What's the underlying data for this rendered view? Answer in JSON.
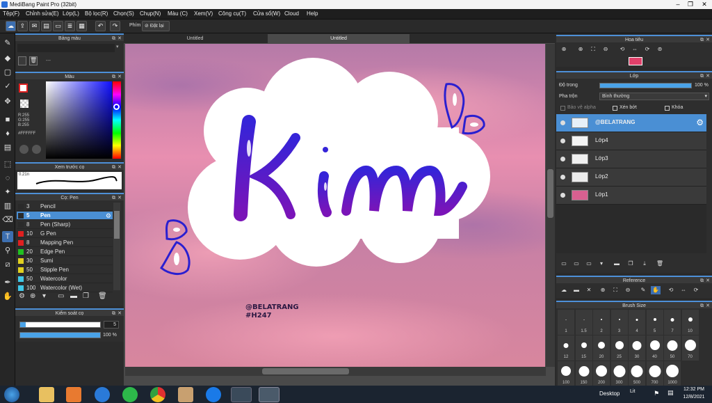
{
  "window": {
    "title": "MediBang Paint Pro (32bit)",
    "controls": [
      "–",
      "❐",
      "✕"
    ]
  },
  "menu": [
    "Tệp(F)",
    "Chỉnh sửa(E)",
    "Lớp(L)",
    "Bộ lọc(R)",
    "Chọn(S)",
    "Chụp(N)",
    "Màu (C)",
    "Xem(V)",
    "Công cụ(T)",
    "Cửa sổ(W)",
    "Cloud",
    "Help"
  ],
  "toolbar": {
    "shortcut_label": "Phím",
    "reset_label": "Đặt lại"
  },
  "tabs": [
    "Untitled",
    "Untitled"
  ],
  "palette_panel": {
    "title": "Bảng màu",
    "entry": "---"
  },
  "color_panel": {
    "title": "Màu",
    "r": "R:255",
    "g": "G:255",
    "b": "B:255",
    "hex": "#FFFFFF"
  },
  "preview_panel": {
    "title": "Xem trước cọ",
    "size": "0.21n"
  },
  "brush_panel": {
    "title": "Cọ: Pen",
    "brushes": [
      {
        "size": "3",
        "name": "Pencil",
        "color": "#2a2a2a"
      },
      {
        "size": "5",
        "name": "Pen",
        "color": "#2a2a2a"
      },
      {
        "size": "8",
        "name": "Pen (Sharp)",
        "color": "#2a2a2a"
      },
      {
        "size": "10",
        "name": "G Pen",
        "color": "#e02020"
      },
      {
        "size": "8",
        "name": "Mapping Pen",
        "color": "#e02020"
      },
      {
        "size": "20",
        "name": "Edge Pen",
        "color": "#20c020"
      },
      {
        "size": "30",
        "name": "Sumi",
        "color": "#e0d020"
      },
      {
        "size": "50",
        "name": "Stipple Pen",
        "color": "#e0d020"
      },
      {
        "size": "50",
        "name": "Watercolor",
        "color": "#40c8e8"
      },
      {
        "size": "100",
        "name": "Watercolor (Wet)",
        "color": "#40c8e8"
      }
    ]
  },
  "brush_control": {
    "title": "Kiểm soát cọ",
    "size": "5",
    "opacity": "100 %",
    "opacity_level": 1.0
  },
  "navigator": {
    "title": "Hoa tiêu"
  },
  "layer_panel": {
    "title": "Lớp",
    "opacity_label": "Độ trong",
    "opacity_value": "100 %",
    "opacity_level": 1.0,
    "blend_label": "Pha trộn",
    "blend_value": "Bình thường",
    "protect_alpha": "Bảo vệ alpha",
    "clipping": "Xén bớt",
    "lock": "Khóa",
    "layers": [
      {
        "name": "@BELATRANG",
        "selected": true
      },
      {
        "name": "Lớp4",
        "selected": false
      },
      {
        "name": "Lớp3",
        "selected": false
      },
      {
        "name": "Lớp2",
        "selected": false
      },
      {
        "name": "Lớp1",
        "selected": false
      }
    ]
  },
  "reference_panel": {
    "title": "Reference"
  },
  "brush_size_panel": {
    "title": "Brush Size",
    "row1": [
      "1",
      "1.5",
      "2",
      "3",
      "4",
      "5",
      "7",
      "10"
    ],
    "row2": [
      "12",
      "15",
      "20",
      "25",
      "30",
      "40",
      "50",
      "70"
    ],
    "row3": [
      "100",
      "150",
      "200",
      "300",
      "500",
      "700",
      "1000"
    ]
  },
  "artwork": {
    "word": "Kim",
    "watermark": "@BELATRANG",
    "hashtag": "#H247"
  },
  "taskbar": {
    "desktop": "Desktop",
    "lang": "Lit",
    "time": "12:32 PM",
    "date": "12/8/2021"
  },
  "colors": {
    "accent": "#4a8fd4",
    "ink": "#3a1fc8",
    "ink2": "#6a18c0"
  }
}
